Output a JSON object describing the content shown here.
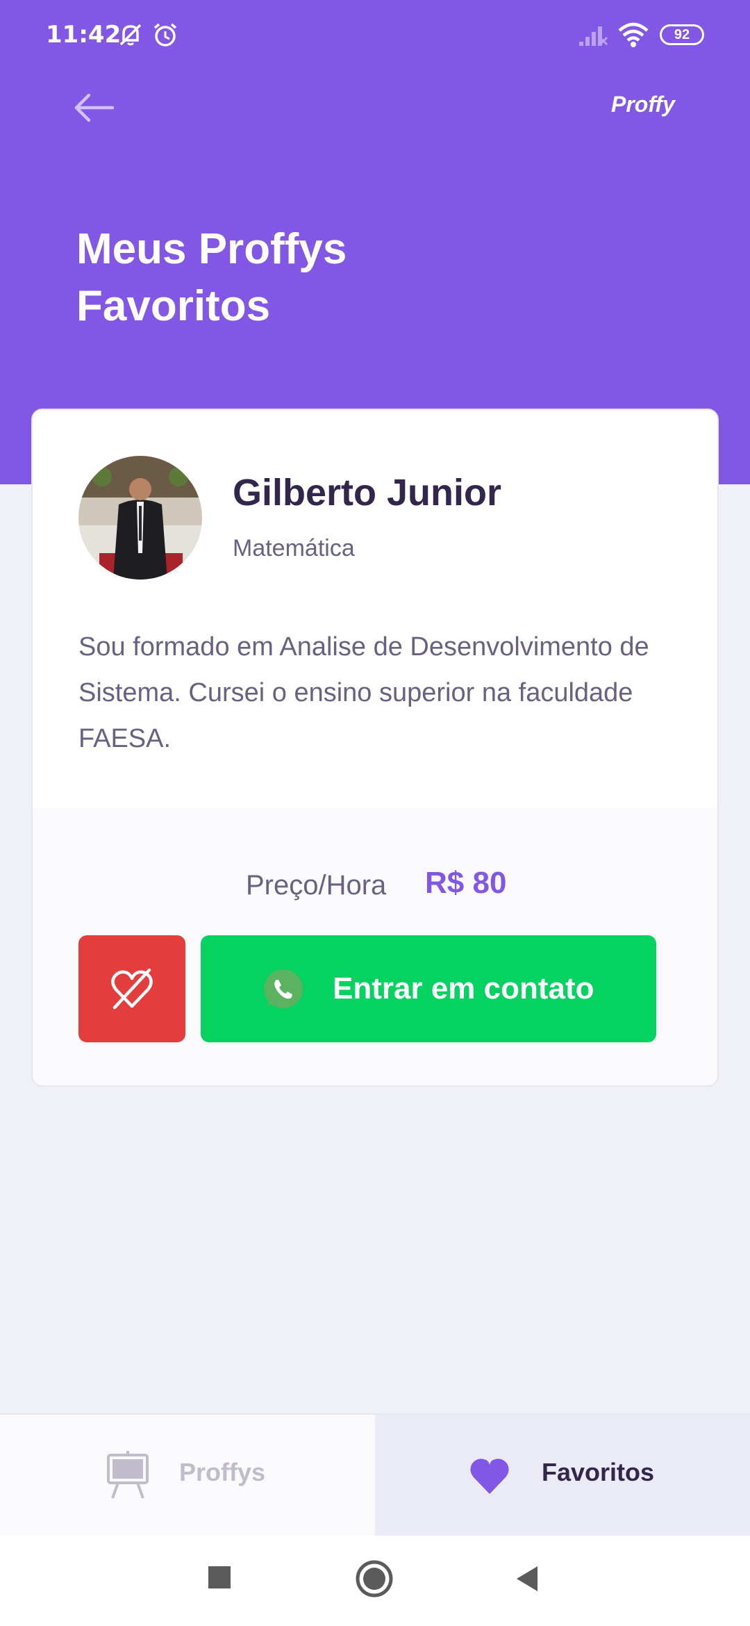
{
  "status_bar": {
    "time": "11:42",
    "battery": "92",
    "icons": [
      "bell-off-icon",
      "alarm-icon",
      "signal-icon",
      "wifi-icon",
      "battery-icon"
    ]
  },
  "header": {
    "back_icon": "arrow-left-icon",
    "brand": "Proffy",
    "title_line1": "Meus Proffys",
    "title_line2": "Favoritos"
  },
  "teacher_card": {
    "name": "Gilberto Junior",
    "subject": "Matemática",
    "bio": "Sou formado em Analise de Desenvolvimento de Sistema. Cursei o ensino superior na faculdade FAESA.",
    "price_label": "Preço/Hora",
    "price_value": "R$ 80",
    "unfavorite_icon": "heart-outline-icon",
    "contact_label": "Entrar em contato",
    "contact_icon": "whatsapp-icon"
  },
  "tabs": [
    {
      "label": "Proffys",
      "icon": "easel-icon",
      "active": false
    },
    {
      "label": "Favoritos",
      "icon": "heart-icon",
      "active": true
    }
  ],
  "colors": {
    "primary": "#8257E5",
    "background": "#F0F0F7",
    "title_text": "#32264D",
    "body_text": "#6A6180",
    "danger": "#E33D3D",
    "secondary": "#04D361"
  },
  "nav_bar": [
    "recents-square-icon",
    "home-circle-icon",
    "back-triangle-icon"
  ]
}
